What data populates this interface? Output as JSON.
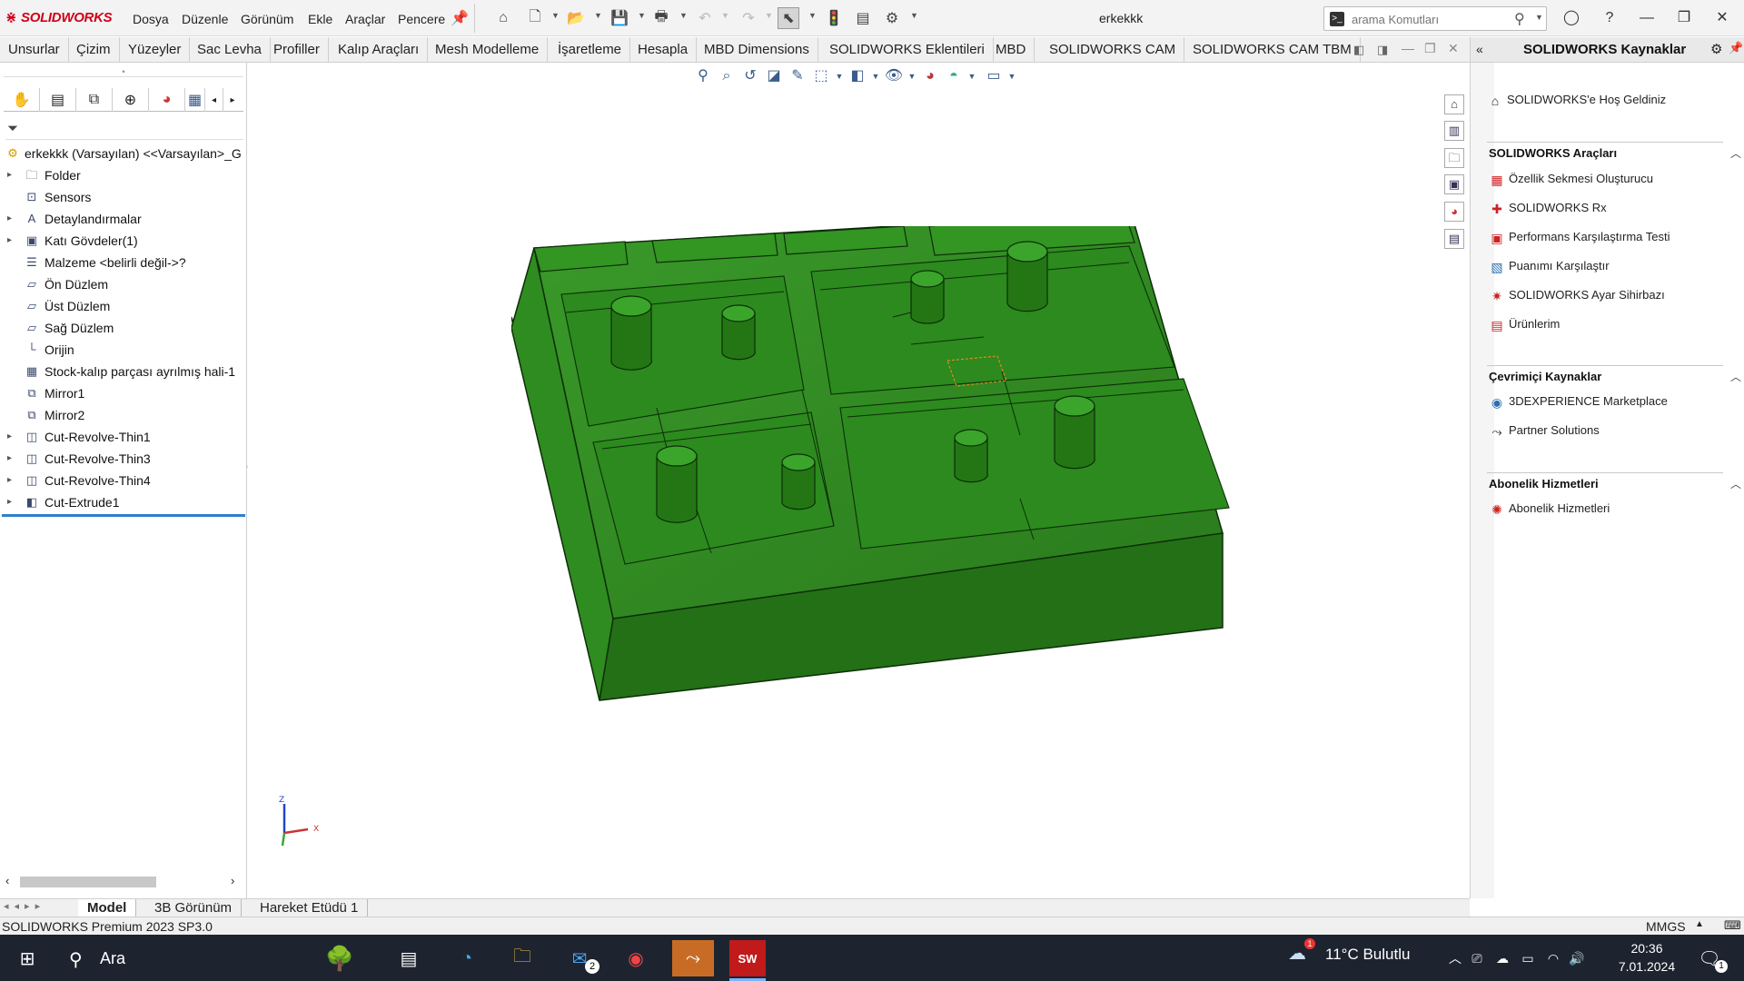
{
  "app": {
    "logo_text": "SOLIDWORKS",
    "document_title": "erkekkk",
    "menus": [
      "Dosya",
      "Düzenle",
      "Görünüm",
      "Ekle",
      "Araçlar",
      "Pencere"
    ],
    "search_placeholder": "arama Komutları"
  },
  "command_tabs": [
    "Unsurlar",
    "Çizim",
    "Yüzeyler",
    "Sac Levha",
    "Profiller",
    "Kalıp Araçları",
    "Mesh Modelleme",
    "İşaretleme",
    "Hesapla",
    "MBD Dimensions",
    "SOLIDWORKS Eklentileri",
    "MBD",
    "SOLIDWORKS CAM",
    "SOLIDWORKS CAM TBM"
  ],
  "feature_tree": {
    "root": "erkekkk (Varsayılan) <<Varsayılan>_G",
    "items": [
      {
        "label": "Folder",
        "icon": "folder-icon",
        "expandable": true
      },
      {
        "label": "Sensors",
        "icon": "sensor-icon",
        "expandable": false
      },
      {
        "label": "Detaylandırmalar",
        "icon": "annotation-icon",
        "expandable": true
      },
      {
        "label": "Katı Gövdeler(1)",
        "icon": "solid-bodies-icon",
        "expandable": true
      },
      {
        "label": "Malzeme <belirli değil->?",
        "icon": "material-icon",
        "expandable": false
      },
      {
        "label": "Ön Düzlem",
        "icon": "plane-icon",
        "expandable": false
      },
      {
        "label": "Üst Düzlem",
        "icon": "plane-icon",
        "expandable": false
      },
      {
        "label": "Sağ Düzlem",
        "icon": "plane-icon",
        "expandable": false
      },
      {
        "label": "Orijin",
        "icon": "origin-icon",
        "expandable": false
      },
      {
        "label": "Stock-kalıp parçası ayrılmış hali-1",
        "icon": "stock-icon",
        "expandable": false
      },
      {
        "label": "Mirror1",
        "icon": "mirror-icon",
        "expandable": false
      },
      {
        "label": "Mirror2",
        "icon": "mirror-icon",
        "expandable": false
      },
      {
        "label": "Cut-Revolve-Thin1",
        "icon": "cut-revolve-icon",
        "expandable": true
      },
      {
        "label": "Cut-Revolve-Thin3",
        "icon": "cut-revolve-icon",
        "expandable": true
      },
      {
        "label": "Cut-Revolve-Thin4",
        "icon": "cut-revolve-icon",
        "expandable": true
      },
      {
        "label": "Cut-Extrude1",
        "icon": "cut-extrude-icon",
        "expandable": true
      }
    ]
  },
  "triad": {
    "z": "Z",
    "x": "X"
  },
  "taskpane": {
    "title": "SOLIDWORKS Kaynaklar",
    "welcome": "SOLIDWORKS'e Hoş Geldiniz",
    "sections": [
      {
        "title": "SOLIDWORKS Araçları",
        "items": [
          "Özellik Sekmesi Oluşturucu",
          "SOLIDWORKS Rx",
          "Performans Karşılaştırma Testi",
          "Puanımı Karşılaştır",
          "SOLIDWORKS Ayar Sihirbazı",
          "Ürünlerim"
        ]
      },
      {
        "title": "Çevrimiçi Kaynaklar",
        "items": [
          "3DEXPERIENCE Marketplace",
          "Partner Solutions"
        ]
      },
      {
        "title": "Abonelik Hizmetleri",
        "items": [
          "Abonelik Hizmetleri"
        ]
      }
    ]
  },
  "bottom_tabs": [
    "Model",
    "3B Görünüm",
    "Hareket Etüdü 1"
  ],
  "status": {
    "text": "SOLIDWORKS Premium 2023 SP3.0",
    "units": "MMGS"
  },
  "taskbar": {
    "search_text": "Ara",
    "mail_badge": "2",
    "weather": "11°C  Bulutlu",
    "weather_badge": "1",
    "time": "20:36",
    "date": "7.01.2024",
    "notification_count": "1"
  },
  "colors": {
    "model_green": "#2e8b1f",
    "model_dark": "#1f6414",
    "accent_red": "#d10019"
  }
}
